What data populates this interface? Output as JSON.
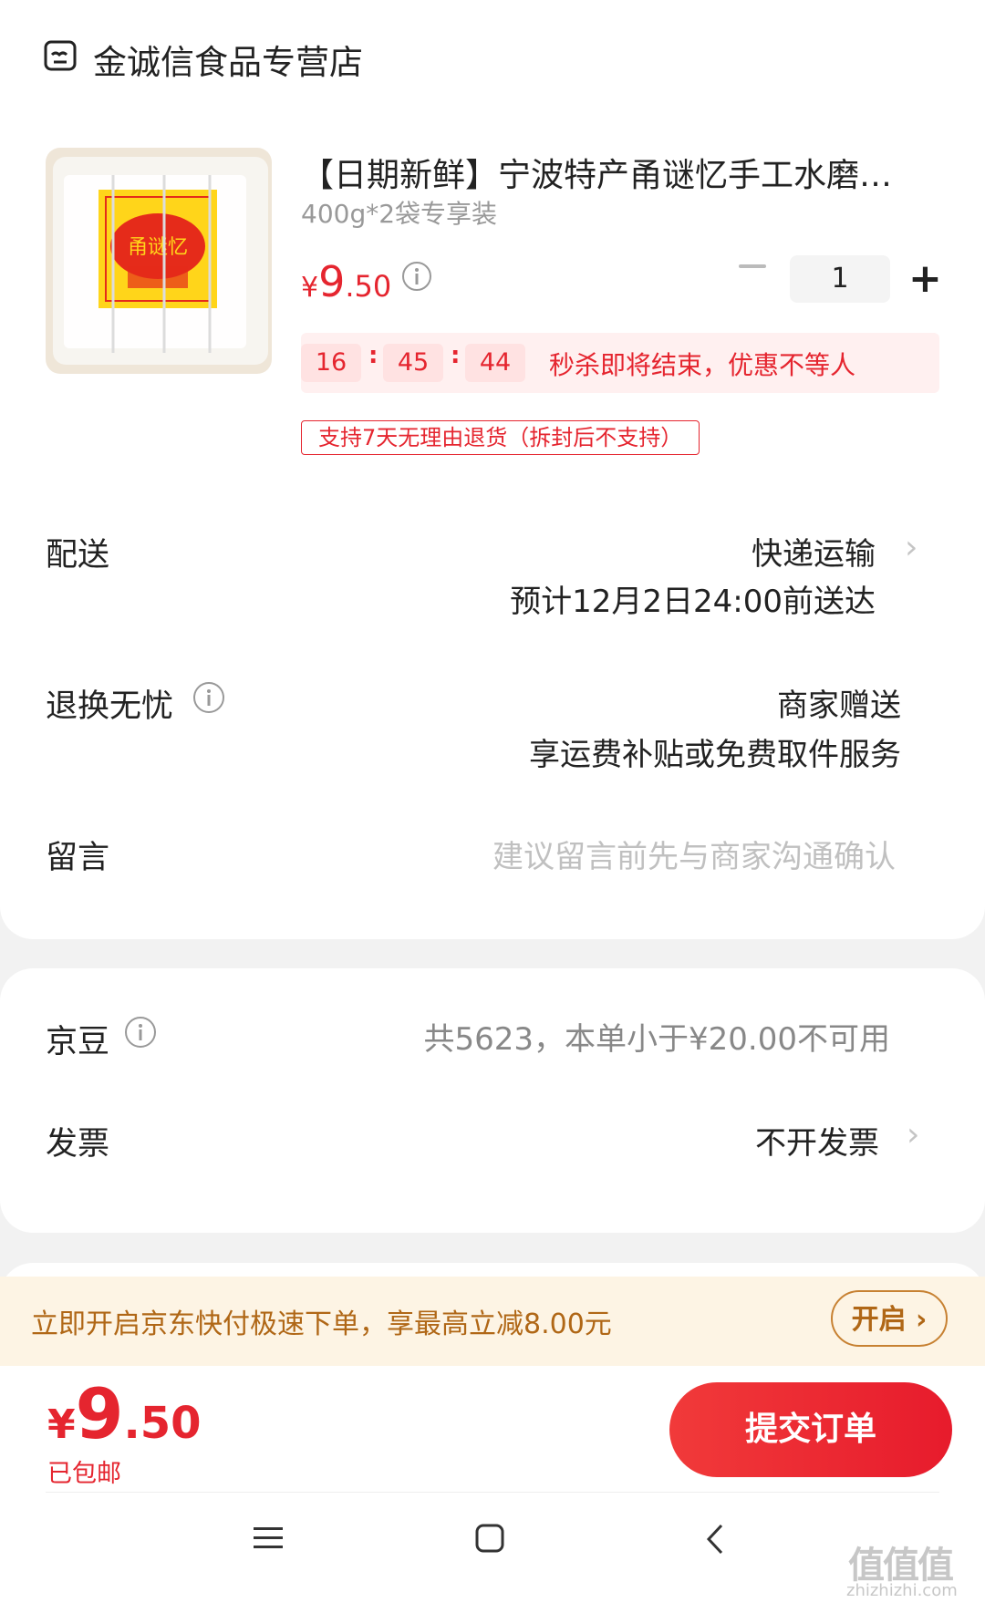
{
  "store": {
    "name": "金诚信食品专营店"
  },
  "product": {
    "title": "【日期新鲜】宁波特产甬谜忆手工水磨年…",
    "spec": "400g*2袋专享装",
    "price_symbol": "¥",
    "price_int": "9",
    "price_dec": ".50",
    "quantity": "1",
    "image_label": "甬谜忆"
  },
  "seckill": {
    "hours": "16",
    "minutes": "45",
    "seconds": "44",
    "sep": ":",
    "text": "秒杀即将结束，优惠不等人"
  },
  "return_tag": "支持7天无理由退货（拆封后不支持）",
  "delivery": {
    "label": "配送",
    "method": "快递运输",
    "eta": "预计12月2日24:00前送达"
  },
  "returns": {
    "label": "退换无忧",
    "value": "商家赠送",
    "detail": "享运费补贴或免费取件服务"
  },
  "message": {
    "label": "留言",
    "placeholder": "建议留言前先与商家沟通确认"
  },
  "jingdou": {
    "label": "京豆",
    "value": "共5623，本单小于¥20.00不可用"
  },
  "invoice": {
    "label": "发票",
    "value": "不开发票"
  },
  "fastpay": {
    "text": "立即开启京东快付极速下单，享最高立减8.00元",
    "button": "开启 ›"
  },
  "footer": {
    "price_symbol": "¥",
    "price_int": "9",
    "price_dec": ".50",
    "shipping": "已包邮",
    "submit": "提交订单"
  },
  "watermark": {
    "main": "值值值",
    "sub": "zhizhizhi.com"
  },
  "colors": {
    "accent": "#e5252f",
    "fastpay_bg": "#fdf4e4",
    "fastpay_text": "#b06716"
  }
}
